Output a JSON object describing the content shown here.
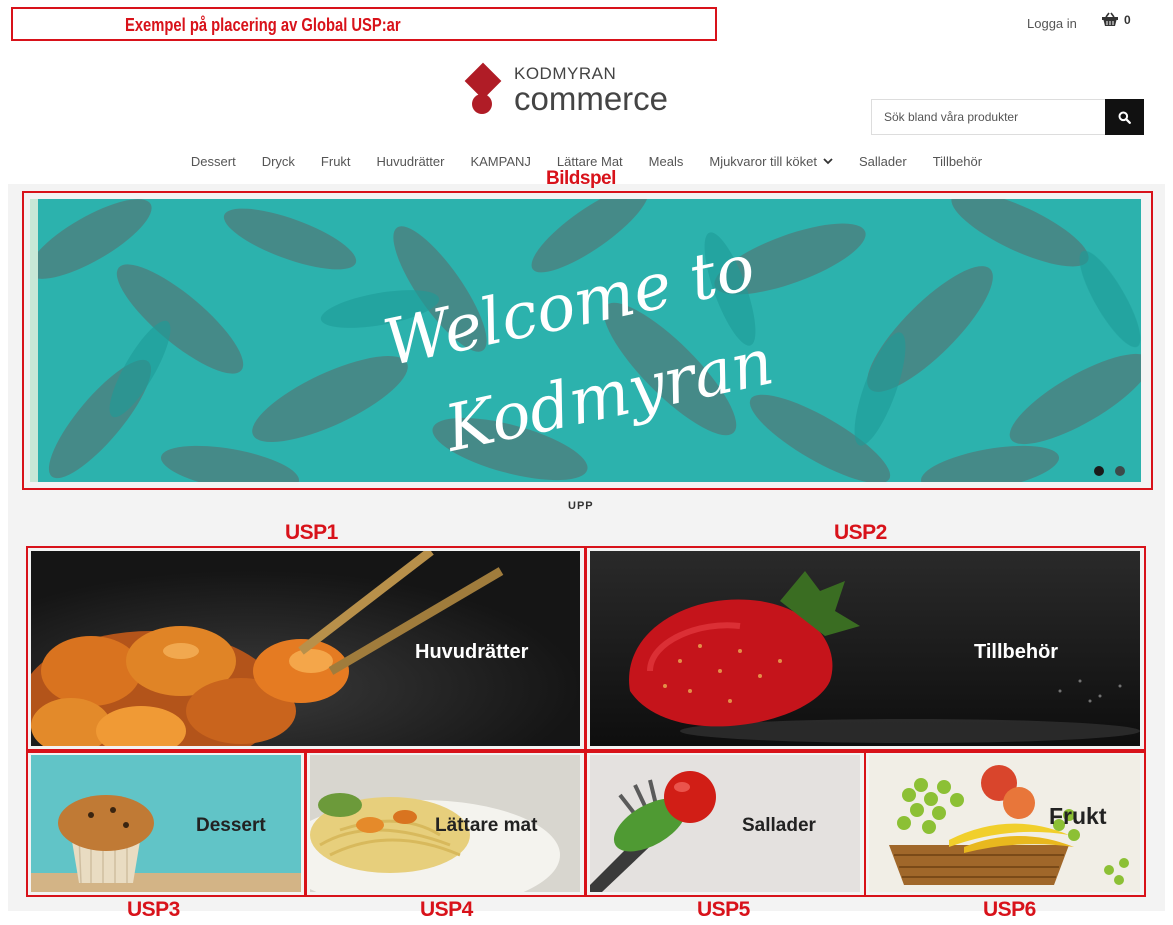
{
  "annotations": {
    "global_usp": "Exempel på placering av Global USP:ar",
    "slideshow": "Bildspel",
    "usp1": "USP1",
    "usp2": "USP2",
    "usp3": "USP3",
    "usp4": "USP4",
    "usp5": "USP5",
    "usp6": "USP6",
    "color": "#d8121a"
  },
  "header": {
    "login": "Logga in",
    "cart_count": "0",
    "logo_line1": "KODMYRAN",
    "logo_line2": "commerce",
    "brand_color": "#b01c26"
  },
  "search": {
    "placeholder": "Sök bland våra produkter",
    "icon": "search-icon"
  },
  "nav": {
    "items": [
      "Dessert",
      "Dryck",
      "Frukt",
      "Huvudrätter",
      "KAMPANJ",
      "Lättare Mat",
      "Meals",
      "Mjukvaror till köket",
      "Sallader",
      "Tillbehör"
    ],
    "dropdown_icon": "chevron-down-icon"
  },
  "slideshow": {
    "line1": "Welcome to",
    "line2": "Kodmyran",
    "slide_count": 2,
    "active_slide": 1
  },
  "upp": "UPP",
  "tiles": {
    "usp1": "Huvudrätter",
    "usp2": "Tillbehör",
    "usp3": "Dessert",
    "usp4": "Lättare mat",
    "usp5": "Sallader",
    "usp6": "Frukt"
  }
}
